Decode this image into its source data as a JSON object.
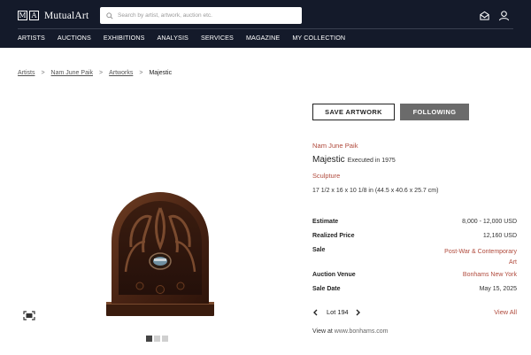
{
  "header": {
    "logo_box_1": "M",
    "logo_box_2": "A",
    "logo_name": "MutualArt",
    "search_placeholder": "Search by artist, artwork, auction etc.",
    "icons": [
      "mail-icon",
      "user-icon"
    ],
    "nav": [
      "ARTISTS",
      "AUCTIONS",
      "EXHIBITIONS",
      "ANALYSIS",
      "SERVICES",
      "MAGAZINE",
      "MY COLLECTION"
    ]
  },
  "breadcrumb": {
    "items": [
      "Artists",
      "Nam June Paik",
      "Artworks"
    ],
    "separator": ">",
    "current": "Majestic"
  },
  "gallery": {
    "dots_total": 3,
    "active_dot": 0
  },
  "actions": {
    "save_label": "SAVE ARTWORK",
    "follow_label": "FOLLOWING"
  },
  "artwork": {
    "artist": "Nam June Paik",
    "title": "Majestic",
    "executed": "Executed in 1975",
    "category": "Sculpture",
    "dimensions": "17 1/2 x 16 x 10 1/8 in (44.5 x 40.6 x 25.7 cm)"
  },
  "details": {
    "estimate_label": "Estimate",
    "estimate_value": "8,000 - 12,000 USD",
    "realized_label": "Realized Price",
    "realized_value": "12,160 USD",
    "sale_label": "Sale",
    "sale_value_line1": "Post-War & Contemporary",
    "sale_value_line2": "Art",
    "venue_label": "Auction Venue",
    "venue_value": "Bonhams New York",
    "date_label": "Sale Date",
    "date_value": "May 15, 2025"
  },
  "lot": {
    "label": "Lot 194",
    "view_all": "View All"
  },
  "source": {
    "prefix": "View at",
    "site": "www.bonhams.com"
  },
  "colors": {
    "header_bg": "#141a2a",
    "accent_link": "#b04a3c",
    "following_bg": "#6b6b6b"
  }
}
